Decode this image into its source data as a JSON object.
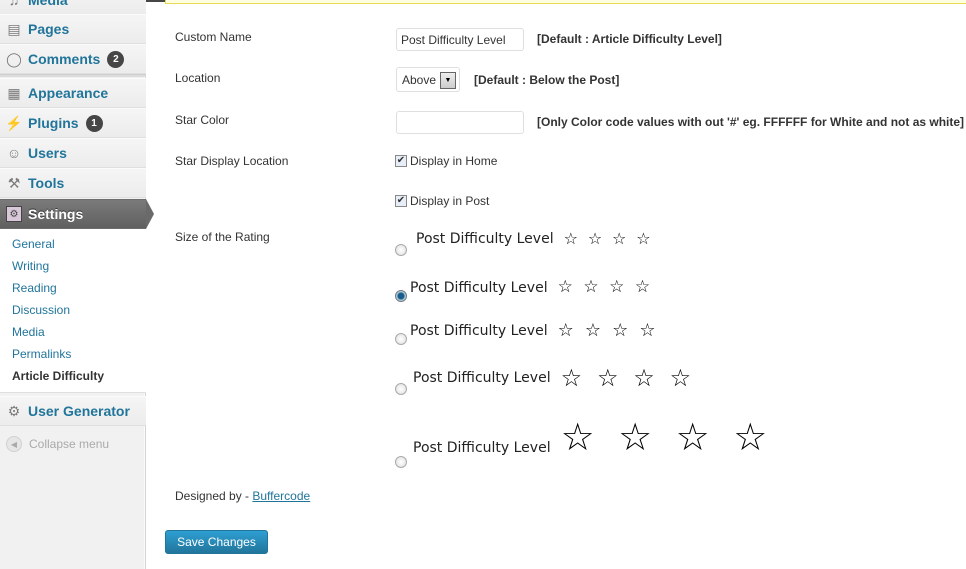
{
  "sidebar": {
    "top_partial_label": "Media",
    "items": [
      {
        "label": "Pages",
        "icon": "pages-icon",
        "glyph": "▤"
      },
      {
        "label": "Comments",
        "icon": "comments-icon",
        "glyph": "💬",
        "badge": "2"
      },
      {
        "label": "Appearance",
        "icon": "appearance-icon",
        "glyph": "▦"
      },
      {
        "label": "Plugins",
        "icon": "plugins-icon",
        "glyph": "⚡",
        "badge": "1"
      },
      {
        "label": "Users",
        "icon": "users-icon",
        "glyph": "👥"
      },
      {
        "label": "Tools",
        "icon": "tools-icon",
        "glyph": "🔧"
      },
      {
        "label": "Settings",
        "icon": "settings-icon",
        "glyph": "⚙"
      }
    ],
    "submenu": [
      "General",
      "Writing",
      "Reading",
      "Discussion",
      "Media",
      "Permalinks",
      "Article Difficulty"
    ],
    "user_generator": {
      "label": "User Generator",
      "glyph": "⚙"
    },
    "collapse_label": "Collapse menu"
  },
  "form": {
    "custom_name": {
      "label": "Custom Name",
      "value": "Post Difficulty Level",
      "hint": "[Default : Article Difficulty Level]"
    },
    "location": {
      "label": "Location",
      "selected": "Above",
      "hint": "[Default : Below the Post]"
    },
    "star_color": {
      "label": "Star Color",
      "value": "",
      "hint": "[Only Color code values with out '#' eg. FFFFFF for White and not as white]"
    },
    "star_display": {
      "label": "Star Display Location",
      "options": [
        {
          "label": "Display in Home",
          "checked": true
        },
        {
          "label": "Display in Post",
          "checked": true
        }
      ]
    },
    "rating_size": {
      "label": "Size of the Rating",
      "selected_index": 1,
      "options": [
        {
          "text": "Post Difficulty Level",
          "stars": "☆ ☆ ☆ ☆"
        },
        {
          "text": "Post Difficulty Level",
          "stars": "☆ ☆ ☆ ☆"
        },
        {
          "text": "Post Difficulty Level",
          "stars": "☆ ☆ ☆ ☆"
        },
        {
          "text": "Post Difficulty Level",
          "stars": "☆ ☆ ☆ ☆"
        },
        {
          "text": "Post Difficulty Level",
          "stars": "☆ ☆ ☆ ☆"
        }
      ]
    },
    "designed_by": {
      "prefix": "Designed by - ",
      "link": "Buffercode"
    },
    "save_label": "Save Changes"
  }
}
